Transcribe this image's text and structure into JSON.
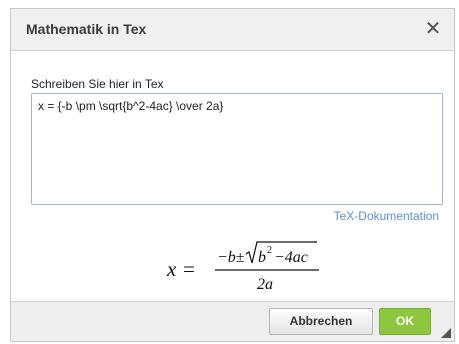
{
  "dialog": {
    "title": "Mathematik in Tex",
    "close_glyph": "✕"
  },
  "editor": {
    "label": "Schreiben Sie hier in Tex",
    "value": "x = {-b \\pm \\sqrt{b^2-4ac} \\over 2a}",
    "doc_link": "TeX-Dokumentation"
  },
  "preview": {
    "lhs": "x",
    "equals": "=",
    "numerator_lead": "−b±",
    "radicand_b": "b",
    "radicand_exp": "2",
    "radicand_rest": "−4ac",
    "denominator": "2a"
  },
  "footer": {
    "cancel_label": "Abbrechen",
    "ok_label": "OK"
  },
  "colors": {
    "link": "#5b8fd0",
    "ok_button": "#8dc63f",
    "input_border": "#9fb9d6"
  }
}
